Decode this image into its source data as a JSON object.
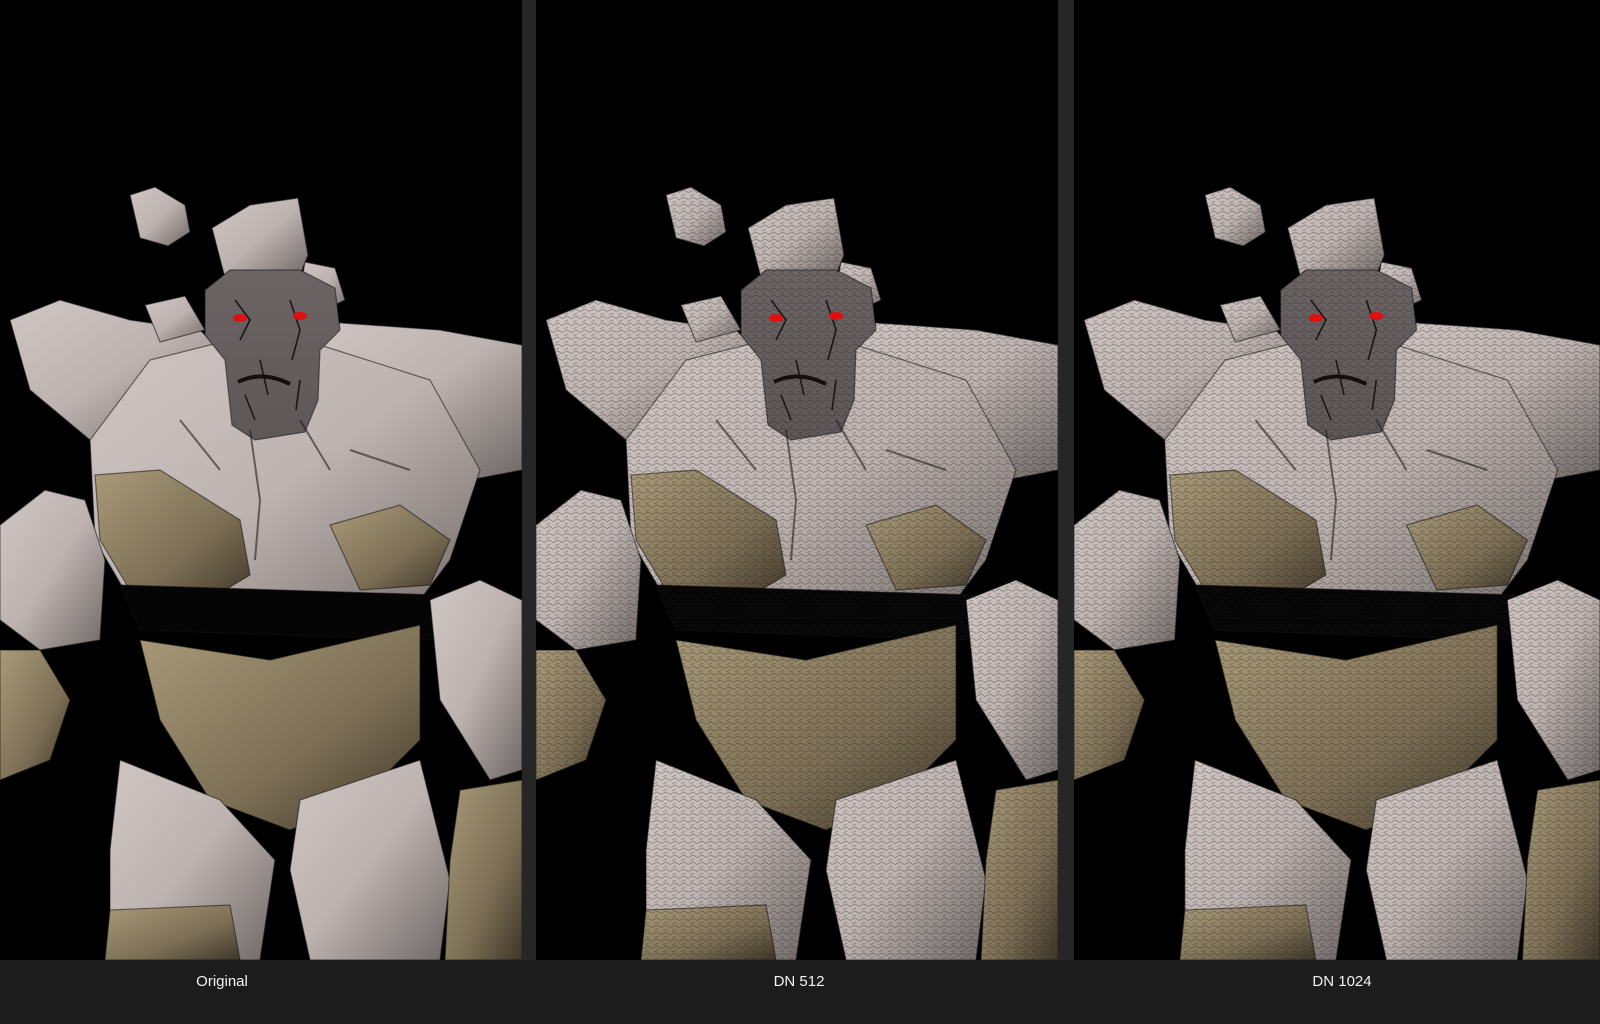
{
  "comparison": {
    "panels": [
      {
        "label": "Original",
        "texture": "smooth"
      },
      {
        "label": "DN 512",
        "texture": "detailed"
      },
      {
        "label": "DN 1024",
        "texture": "detailed"
      }
    ]
  },
  "colors": {
    "background": "#000000",
    "caption_bar": "#1c1c1c",
    "divider": "#262626",
    "caption_text": "#f2f2f2",
    "stone_light": "#cfc6c4",
    "stone_dark": "#6f6866",
    "face": "#5e5757",
    "sandstone": "#a89a78",
    "eye": "#e01010"
  }
}
